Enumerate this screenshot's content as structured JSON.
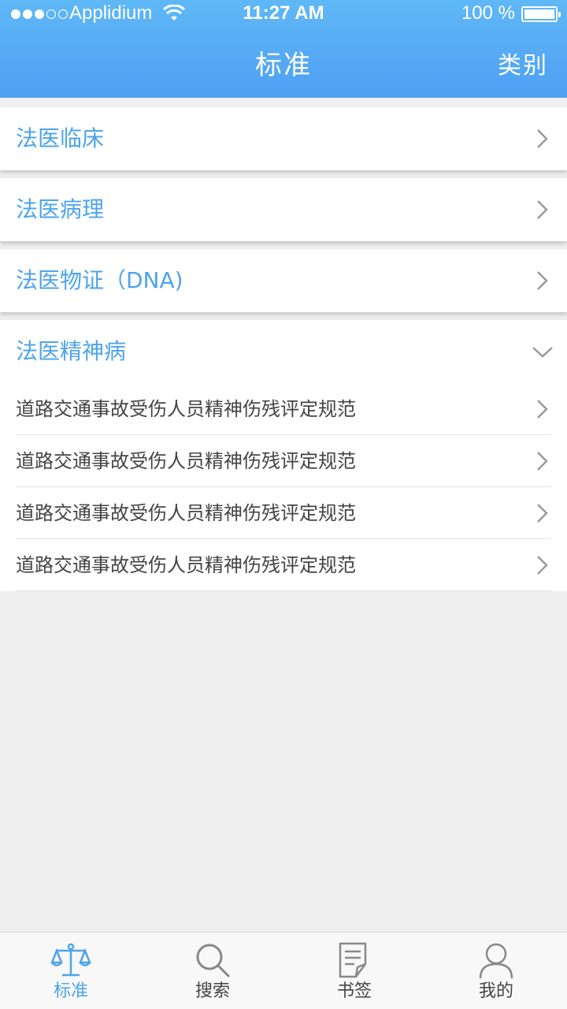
{
  "status_bar": {
    "carrier": "Applidium",
    "time": "11:27 AM",
    "battery": "100 %",
    "signal_bars_filled": 3,
    "signal_bars_total": 5
  },
  "nav": {
    "title": "标准",
    "right_button": "类别"
  },
  "categories": [
    {
      "label": "法医临床",
      "icon": "chevron-right-icon"
    },
    {
      "label": "法医病理",
      "icon": "chevron-right-icon"
    },
    {
      "label": "法医物证（DNA)",
      "icon": "chevron-right-icon"
    },
    {
      "label": "法医精神病",
      "icon": "chevron-down-icon",
      "expanded": true
    }
  ],
  "subitems": [
    {
      "label": "道路交通事故受伤人员精神伤残评定规范"
    },
    {
      "label": "道路交通事故受伤人员精神伤残评定规范"
    },
    {
      "label": "道路交通事故受伤人员精神伤残评定规范"
    },
    {
      "label": "道路交通事故受伤人员精神伤残评定规范"
    }
  ],
  "tabs": [
    {
      "label": "标准",
      "icon": "scale-icon",
      "active": true
    },
    {
      "label": "搜索",
      "icon": "search-icon"
    },
    {
      "label": "书签",
      "icon": "bookmark-icon"
    },
    {
      "label": "我的",
      "icon": "user-icon"
    }
  ],
  "colors": {
    "accent": "#4da4ec",
    "header_top": "#5fb8f6",
    "header_bottom": "#4f9ff3",
    "background": "#efefef"
  }
}
